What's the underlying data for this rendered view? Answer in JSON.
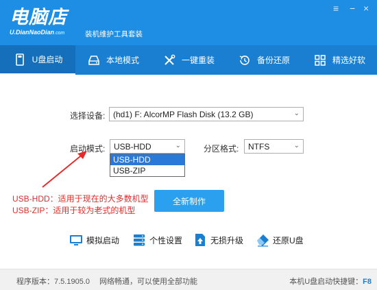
{
  "app": {
    "logo_text": "电脑店",
    "logo_sub": "U.DianNaoDian",
    "logo_com": ".com",
    "tagline": "装机维护工具套装",
    "controls": {
      "menu": "≡",
      "minimize": "−",
      "close": "×"
    }
  },
  "nav": {
    "items": [
      {
        "label": "U盘启动",
        "icon": "usb-drive-icon",
        "active": true
      },
      {
        "label": "本地模式",
        "icon": "hard-disk-icon",
        "active": false
      },
      {
        "label": "一键重装",
        "icon": "tools-icon",
        "active": false
      },
      {
        "label": "备份还原",
        "icon": "restore-icon",
        "active": false
      },
      {
        "label": "精选好软",
        "icon": "apps-grid-icon",
        "active": false
      }
    ]
  },
  "form": {
    "device_label": "选择设备:",
    "device_value": "(hd1) F: AlcorMP Flash Disk (13.2 GB)",
    "boot_mode_label": "启动模式:",
    "boot_mode_value": "USB-HDD",
    "boot_mode_options": [
      "USB-HDD",
      "USB-ZIP"
    ],
    "partition_label": "分区格式:",
    "partition_value": "NTFS"
  },
  "notes": {
    "hdd": "USB-HDD：适用于现在的大多数机型",
    "zip": "USB-ZIP：适用于较为老式的机型"
  },
  "actions": {
    "make_label": "全新制作"
  },
  "tools": [
    {
      "label": "模拟启动",
      "icon": "monitor-icon"
    },
    {
      "label": "个性设置",
      "icon": "server-settings-icon"
    },
    {
      "label": "无损升级",
      "icon": "upgrade-icon"
    },
    {
      "label": "还原U盘",
      "icon": "eraser-icon"
    }
  ],
  "status": {
    "version": "程序版本：7.5.1905.0",
    "network": "网络畅通，可以使用全部功能",
    "hotkey_label": "本机U盘启动快捷键：",
    "hotkey_value": "F8"
  },
  "colors": {
    "header": "#1d8ee4",
    "nav": "#1a7fd1",
    "accent_button": "#2aa0ef",
    "note_red": "#e52c2c",
    "selection": "#2a79d8"
  }
}
